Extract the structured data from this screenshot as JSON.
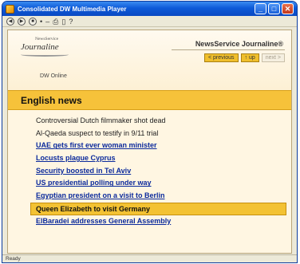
{
  "window": {
    "title": "Consolidated DW Multimedia Player",
    "buttons": {
      "minimize": "_",
      "maximize": "□",
      "close": "✕"
    }
  },
  "toolbar": {
    "items": [
      {
        "icon": "back-icon",
        "glyph": "◀"
      },
      {
        "icon": "forward-icon",
        "glyph": "▶"
      },
      {
        "icon": "stop-icon",
        "glyph": "■"
      },
      {
        "icon": "bullet-icon",
        "glyph": "•"
      },
      {
        "icon": "dash-icon",
        "glyph": "–"
      },
      {
        "icon": "print-icon",
        "glyph": "⎙"
      },
      {
        "icon": "copy-icon",
        "glyph": "▯"
      },
      {
        "icon": "help-icon",
        "glyph": "?"
      }
    ]
  },
  "header": {
    "logo_small": "NewsService",
    "logo_main": "Journaline",
    "brand": "NewsService Journaline®",
    "nav": {
      "previous": "< previous",
      "up": "↑ up",
      "next": "next >"
    },
    "source": "DW Online"
  },
  "section": {
    "title": "English news"
  },
  "news": [
    {
      "text": "Controversial Dutch filmmaker shot dead",
      "link": false
    },
    {
      "text": "Al-Qaeda suspect to testify in 9/11 trial",
      "link": false
    },
    {
      "text": "UAE gets first ever woman minister",
      "link": true
    },
    {
      "text": "Locusts plague Cyprus",
      "link": true
    },
    {
      "text": "Security boosted in Tel Aviv",
      "link": true
    },
    {
      "text": "US presidential polling under way",
      "link": true
    },
    {
      "text": "Egyptian president on a visit to Berlin",
      "link": true
    },
    {
      "text": "Queen Elizabeth to visit Germany",
      "link": true,
      "selected": true
    },
    {
      "text": "ElBaradei addresses General Assembly",
      "link": true
    }
  ],
  "status": {
    "text": "Ready"
  },
  "colors": {
    "accent": "#f6c23a",
    "titlebar": "#0d5ad8",
    "link": "#0b2a9c",
    "background": "#fff6e2"
  }
}
